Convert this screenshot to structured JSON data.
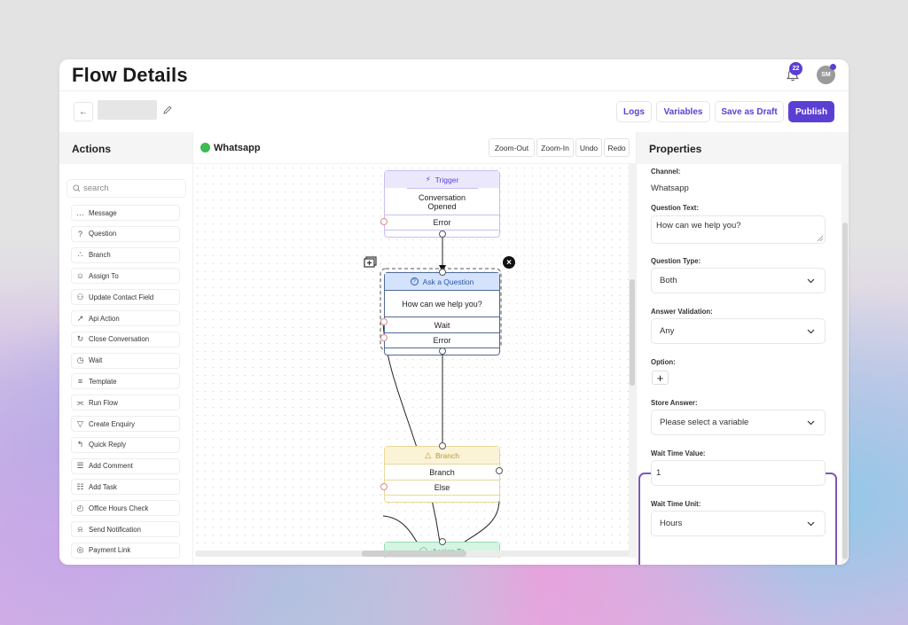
{
  "header": {
    "title": "Flow Details",
    "notification_count": "22",
    "avatar_initials": "SM"
  },
  "toolbar": {
    "back_icon": "arrow-left-icon",
    "flow_name": "",
    "edit_icon": "pencil-icon",
    "logs_label": "Logs",
    "variables_label": "Variables",
    "save_draft_label": "Save as Draft",
    "publish_label": "Publish"
  },
  "actions": {
    "title": "Actions",
    "search_placeholder": "search",
    "items": [
      {
        "label": "Message",
        "icon": "message-icon"
      },
      {
        "label": "Question",
        "icon": "question-icon"
      },
      {
        "label": "Branch",
        "icon": "branch-icon"
      },
      {
        "label": "Assign To",
        "icon": "user-icon"
      },
      {
        "label": "Update Contact Field",
        "icon": "users-icon"
      },
      {
        "label": "Api Action",
        "icon": "api-icon"
      },
      {
        "label": "Close Conversation",
        "icon": "close-conversation-icon"
      },
      {
        "label": "Wait",
        "icon": "clock-icon"
      },
      {
        "label": "Template",
        "icon": "template-icon"
      },
      {
        "label": "Run Flow",
        "icon": "run-flow-icon"
      },
      {
        "label": "Create Enquiry",
        "icon": "filter-icon"
      },
      {
        "label": "Quick Reply",
        "icon": "reply-icon"
      },
      {
        "label": "Add Comment",
        "icon": "comment-icon"
      },
      {
        "label": "Add Task",
        "icon": "task-icon"
      },
      {
        "label": "Office Hours Check",
        "icon": "office-hours-icon"
      },
      {
        "label": "Send Notification",
        "icon": "bell-icon"
      },
      {
        "label": "Payment Link",
        "icon": "payment-icon"
      }
    ]
  },
  "canvas": {
    "channel_title": "Whatsapp",
    "buttons": {
      "zoom_out": "Zoom-Out",
      "zoom_in": "Zoom-In",
      "undo": "Undo",
      "redo": "Redo"
    },
    "nodes": {
      "trigger": {
        "header": "Trigger",
        "body": "Conversation Opened",
        "rows": [
          "Error"
        ]
      },
      "question": {
        "header": "Ask a Question",
        "body": "How can we help you?",
        "rows": [
          "Wait",
          "Error"
        ]
      },
      "branch": {
        "header": "Branch",
        "rows": [
          "Branch",
          "Else"
        ]
      },
      "assign": {
        "header": "Assign To"
      }
    }
  },
  "properties": {
    "title": "Properties",
    "channel_label": "Channel:",
    "channel_value": "Whatsapp",
    "question_text_label": "Question Text:",
    "question_text_value": "How can we help you?",
    "question_type_label": "Question Type:",
    "question_type_value": "Both",
    "answer_validation_label": "Answer Validation:",
    "answer_validation_value": "Any",
    "option_label": "Option:",
    "option_add": "+",
    "store_answer_label": "Store Answer:",
    "store_answer_value": "Please select a variable",
    "wait_time_value_label": "Wait Time Value:",
    "wait_time_value": "1",
    "wait_time_unit_label": "Wait Time Unit:",
    "wait_time_unit_value": "Hours"
  },
  "colors": {
    "brand": "#5b3fd4",
    "highlight_border": "#7e57b5",
    "trigger_header": "#ece8fb",
    "question_header": "#d4e3fb",
    "branch_header": "#fbf3d6",
    "assign_header": "#d3f5e2",
    "whatsapp": "#3dbb54"
  }
}
